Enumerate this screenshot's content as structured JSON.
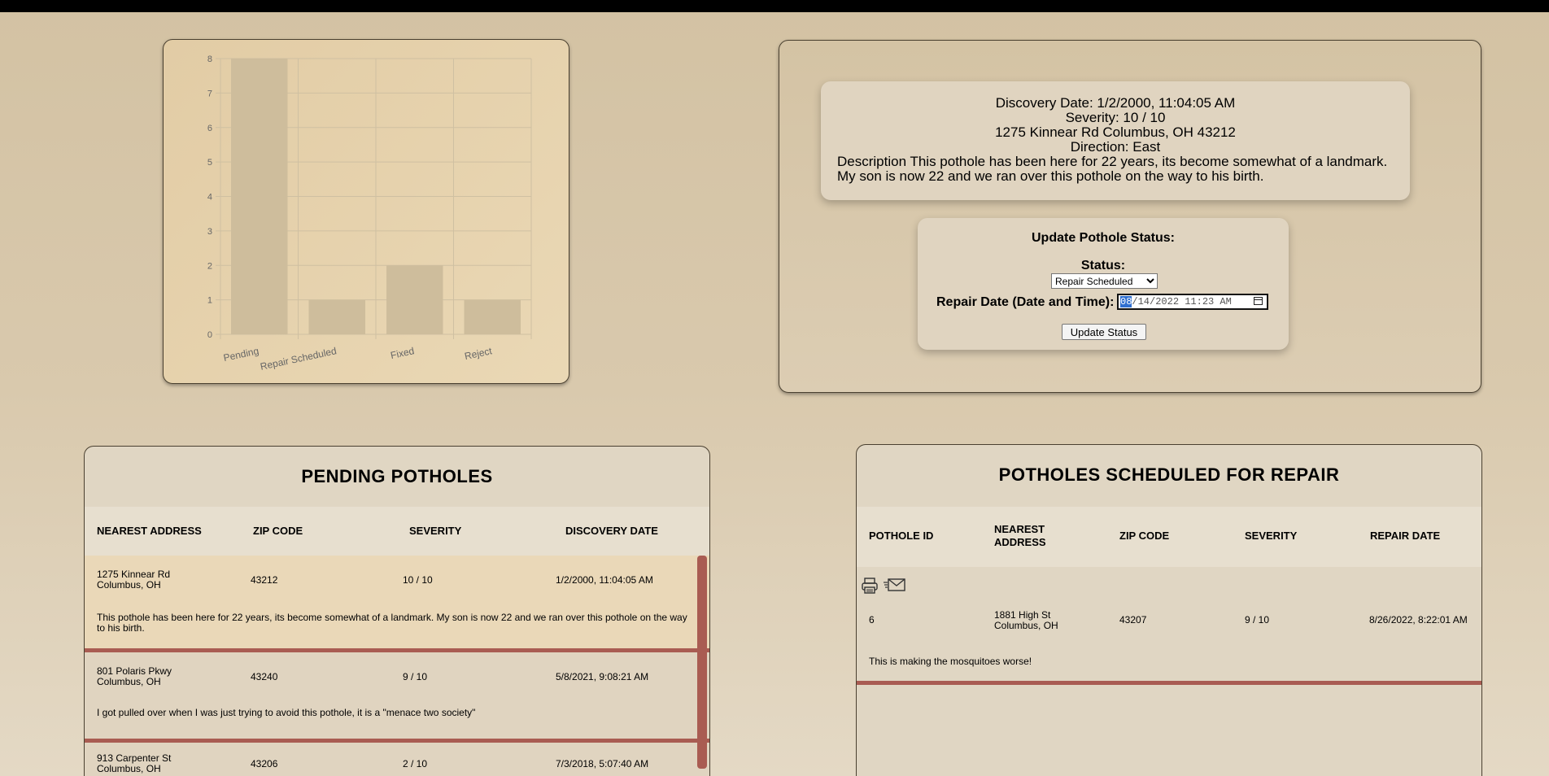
{
  "chart_data": {
    "type": "bar",
    "categories": [
      "Pending",
      "Repair Scheduled",
      "Fixed",
      "Reject"
    ],
    "values": [
      8,
      1,
      2,
      1
    ],
    "ylim": [
      0,
      8
    ],
    "yticks": [
      "0",
      "1",
      "2",
      "3",
      "4",
      "5",
      "6",
      "7",
      "8"
    ],
    "grid": true,
    "bar_color": "#cebd9c"
  },
  "detail": {
    "discovery": "Discovery Date: 1/2/2000, 11:04:05 AM",
    "severity": "Severity: 10 / 10",
    "address": "1275 Kinnear Rd Columbus, OH 43212",
    "direction": "Direction: East",
    "description": "Description This pothole has been here for 22 years, its become somewhat of a landmark. My son is now 22 and we ran over this pothole on the way to his birth."
  },
  "update": {
    "title": "Update Pothole Status:",
    "status_label": "Status:",
    "status_value": "Repair Scheduled",
    "repair_label": "Repair Date (Date and Time):",
    "date_month": "08",
    "date_rest": "/14/2022 11:23 AM",
    "button": "Update Status"
  },
  "pending": {
    "title": "PENDING POTHOLES",
    "headers": [
      "NEAREST ADDRESS",
      "ZIP CODE",
      "SEVERITY",
      "DISCOVERY DATE"
    ],
    "rows": [
      {
        "street": "1275 Kinnear Rd",
        "city": "Columbus, OH",
        "zip": "43212",
        "severity": "10 / 10",
        "date": "1/2/2000, 11:04:05 AM",
        "desc": "This pothole has been here for 22 years, its become somewhat of a landmark. My son is now 22 and we ran over this pothole on the way to his birth."
      },
      {
        "street": "801 Polaris Pkwy",
        "city": "Columbus, OH",
        "zip": "43240",
        "severity": "9 / 10",
        "date": "5/8/2021, 9:08:21 AM",
        "desc": "I got pulled over when I was just trying to avoid this pothole, it is a \"menace two society\""
      },
      {
        "street": "913 Carpenter St",
        "city": "Columbus, OH",
        "zip": "43206",
        "severity": "2 / 10",
        "date": "7/3/2018, 5:07:40 AM",
        "desc": ""
      }
    ]
  },
  "scheduled": {
    "title": "POTHOLES SCHEDULED FOR REPAIR",
    "headers": [
      "POTHOLE ID",
      "NEAREST ADDRESS",
      "ZIP CODE",
      "SEVERITY",
      "REPAIR DATE"
    ],
    "rows": [
      {
        "id": "6",
        "street": "1881 High St",
        "city": "Columbus, OH",
        "zip": "43207",
        "severity": "9 / 10",
        "date": "8/26/2022, 8:22:01 AM",
        "desc": "This is making the mosquitoes worse!"
      }
    ],
    "icons": [
      "printer-icon",
      "mail-icon"
    ]
  },
  "colors": {
    "separator": "#a95c52",
    "scrollbar": "#a95c52"
  }
}
